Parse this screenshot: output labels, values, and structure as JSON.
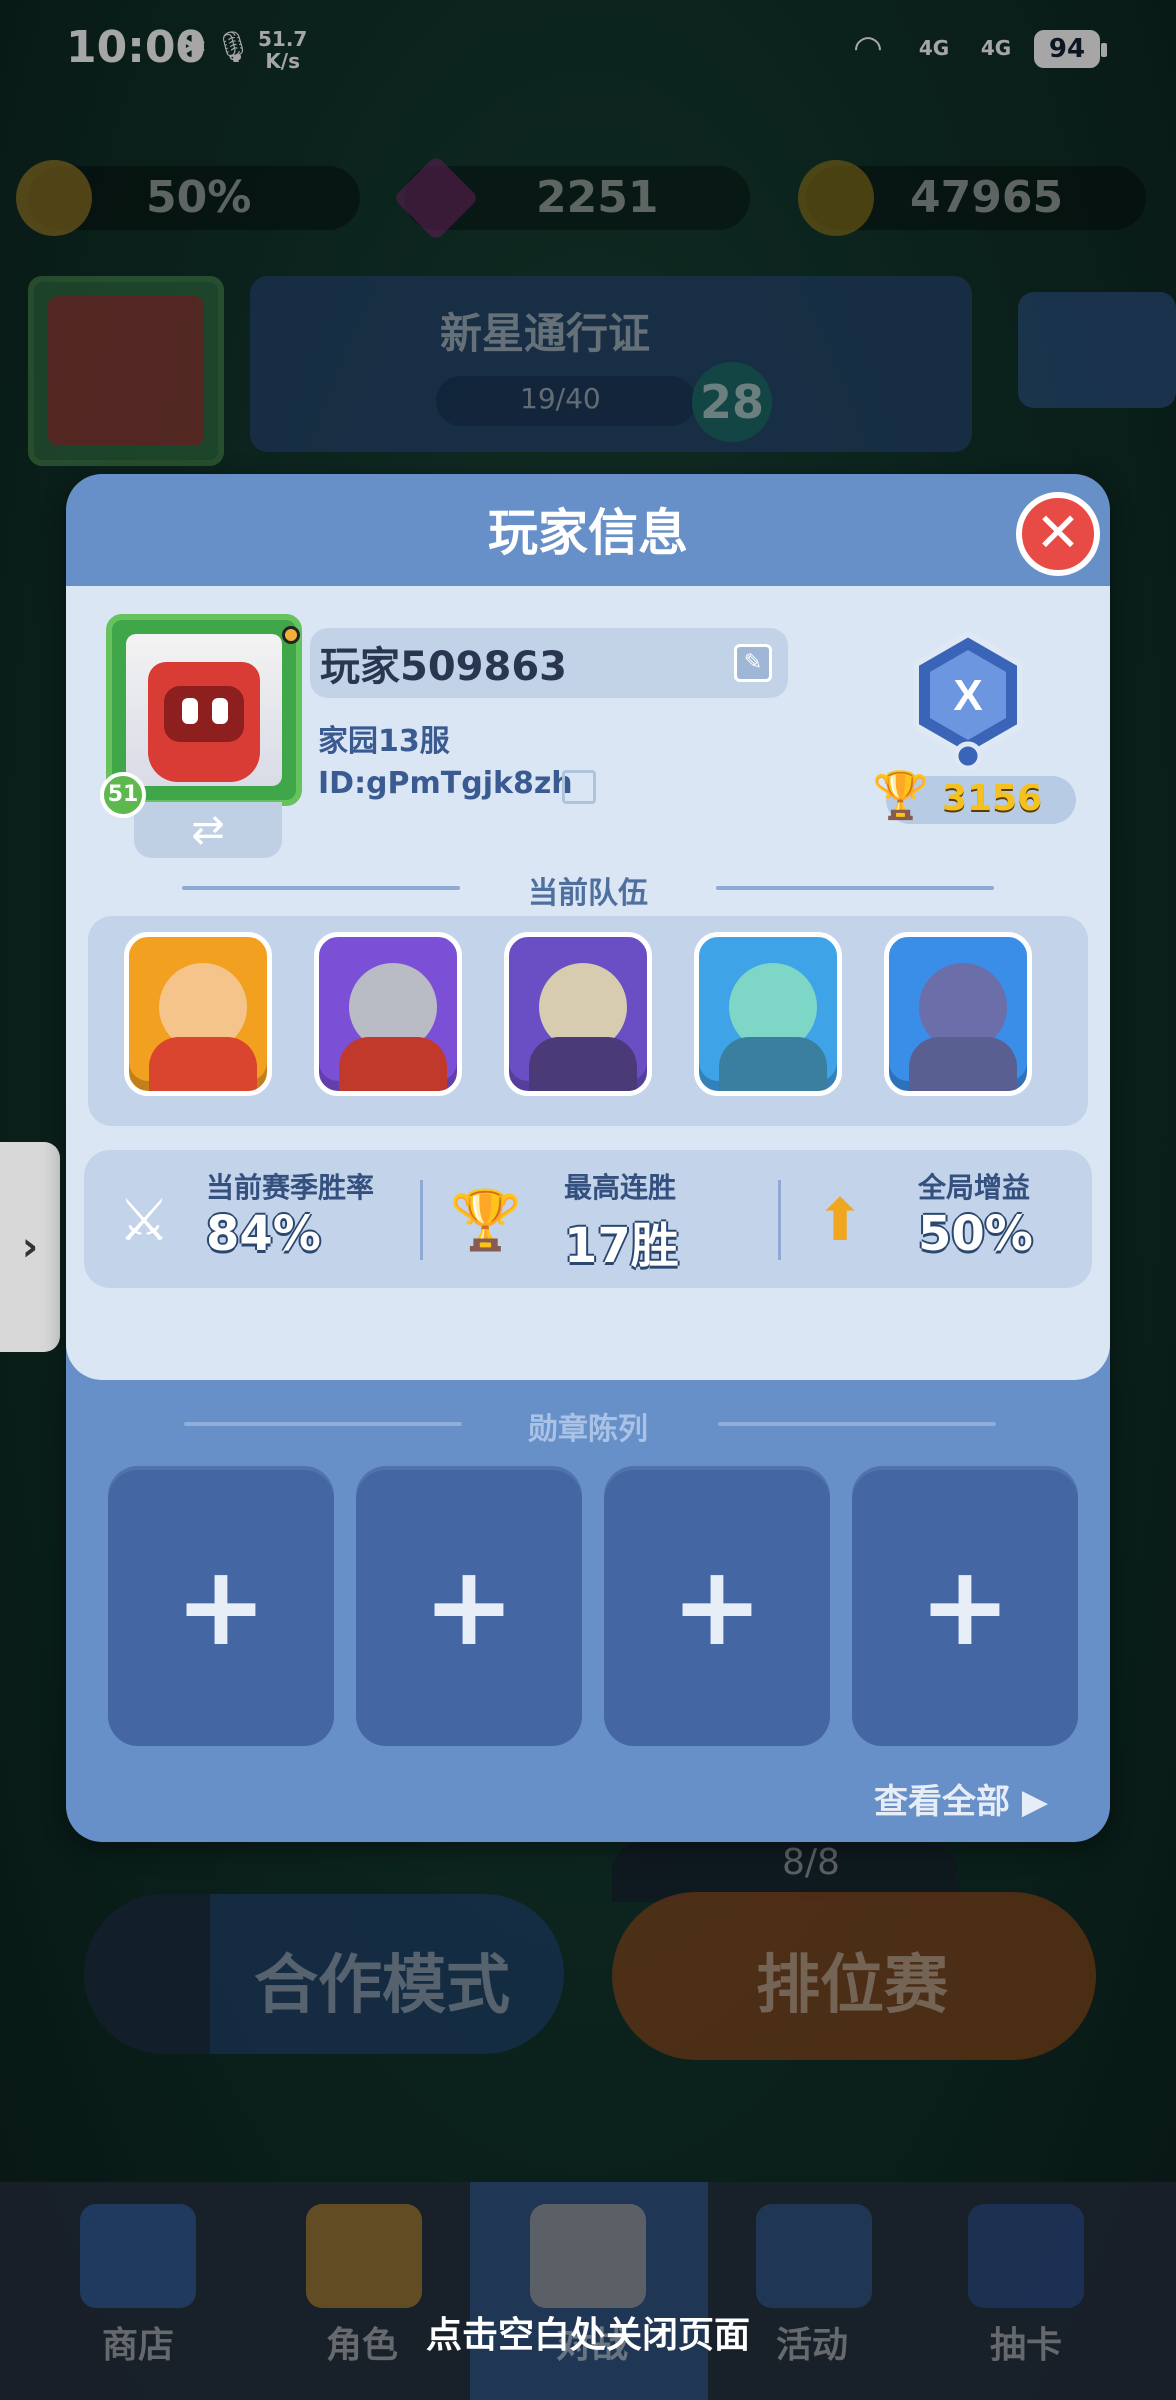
{
  "status_bar": {
    "time": "10:00",
    "net_speed_value": "51.7",
    "net_speed_unit": "K/s",
    "battery": "94",
    "network_1": "4G",
    "network_2": "4G"
  },
  "resources": {
    "boost_percent": "50%",
    "gems": "2251",
    "coins": "47965"
  },
  "pass": {
    "title": "新星通行证",
    "progress_text": "19/40",
    "level": "28",
    "progress_fraction": 0.475
  },
  "modal": {
    "title": "玩家信息",
    "player": {
      "name": "玩家509863",
      "server": "家园13服",
      "id": "ID:gPmTgjk8zh",
      "level": "51",
      "trophies": "3156",
      "rank_letter": "X"
    },
    "team": {
      "title": "当前队伍",
      "heroes": [
        {
          "name": "king-hero",
          "color": "#f2a020"
        },
        {
          "name": "knight-hero",
          "color": "#7b4fd6"
        },
        {
          "name": "dark-knight-hero",
          "color": "#6a4fc4"
        },
        {
          "name": "goblin-hero",
          "color": "#3fa3e8"
        },
        {
          "name": "eye-mage-hero",
          "color": "#3a8ee8"
        }
      ]
    },
    "stats": [
      {
        "label": "当前赛季胜率",
        "value": "84%",
        "icon": "swords-icon"
      },
      {
        "label": "最高连胜",
        "value": "17胜",
        "icon": "trophy-icon"
      },
      {
        "label": "全局增益",
        "value": "50%",
        "icon": "boost-icon"
      }
    ],
    "medals": {
      "title": "勋章陈列",
      "slots": [
        "+",
        "+",
        "+",
        "+"
      ],
      "view_all": "查看全部"
    }
  },
  "background": {
    "coop_mode": "合作模式",
    "ranked": "排位赛",
    "ranked_count": "8/8"
  },
  "bottom_nav": {
    "items": [
      "商店",
      "角色",
      "对战",
      "活动",
      "抽卡"
    ]
  },
  "close_hint": "点击空白处关闭页面"
}
